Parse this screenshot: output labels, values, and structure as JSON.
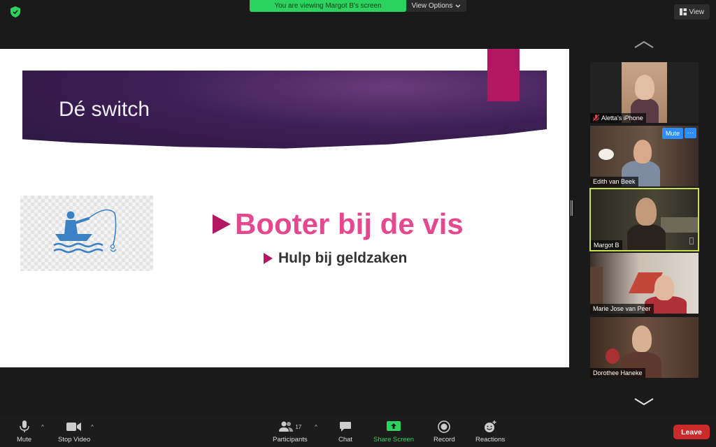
{
  "banner": {
    "text": "You are viewing Margot B's screen",
    "view_options": "View Options"
  },
  "view_button": {
    "label": "View"
  },
  "slide": {
    "title": "Dé switch",
    "bullet_main": "Booter bij de vis",
    "bullet_sub": "Hulp bij geldzaken"
  },
  "participants": [
    {
      "name": "Aletta's iPhone",
      "muted": true
    },
    {
      "name": "Edith van Beek",
      "hover_mute": "Mute",
      "hover_more": "···"
    },
    {
      "name": "Margot B",
      "active_speaker": true
    },
    {
      "name": "Marie Jose van Peer"
    },
    {
      "name": "Dorothee Haneke"
    }
  ],
  "toolbar": {
    "mute": "Mute",
    "stop_video": "Stop Video",
    "participants": "Participants",
    "participants_count": "17",
    "chat": "Chat",
    "share_screen": "Share Screen",
    "record": "Record",
    "reactions": "Reactions",
    "leave": "Leave"
  },
  "colors": {
    "banner_green": "#2bd25e",
    "accent_magenta": "#b31764",
    "bullet_pink": "#e6488f",
    "active_border": "#c8e04a",
    "leave_red": "#cc2a2a",
    "mute_blue": "#2d8cff"
  },
  "icons": {
    "security": "shield-check-icon",
    "view": "grid-view-icon",
    "fish": "fishing-boat-icon"
  }
}
